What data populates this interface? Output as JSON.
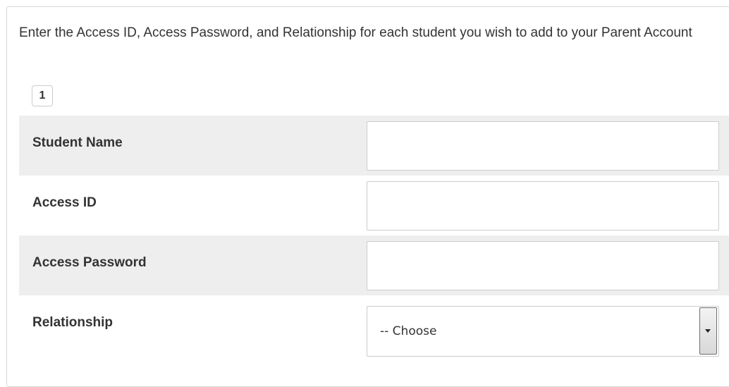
{
  "instructions": "Enter the Access ID, Access Password, and Relationship for each student you wish to add to your Parent Account",
  "student_index": "1",
  "fields": {
    "student_name": {
      "label": "Student Name",
      "value": ""
    },
    "access_id": {
      "label": "Access ID",
      "value": ""
    },
    "access_password": {
      "label": "Access Password",
      "value": ""
    },
    "relationship": {
      "label": "Relationship",
      "selected": "-- Choose"
    }
  }
}
